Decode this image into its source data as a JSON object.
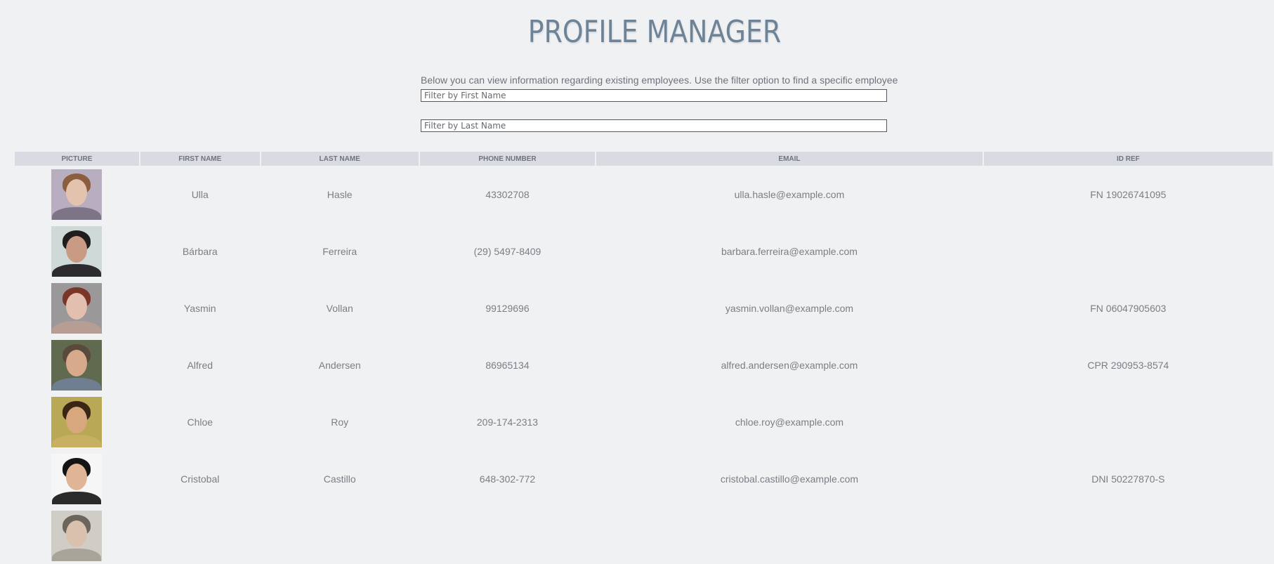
{
  "header": {
    "title": "PROFILE MANAGER",
    "intro": "Below you can view information regarding existing employees. Use the filter option to find a specific employee"
  },
  "filters": {
    "first_name_placeholder": "Filter by First Name",
    "last_name_placeholder": "Filter by Last Name"
  },
  "table": {
    "columns": [
      "PICTURE",
      "FIRST NAME",
      "LAST NAME",
      "PHONE NUMBER",
      "EMAIL",
      "ID REF"
    ],
    "rows": [
      {
        "first": "Ulla",
        "last": "Hasle",
        "phone": "43302708",
        "email": "ulla.hasle@example.com",
        "idref": "FN 19026741095",
        "avatar": {
          "bg": "#b8aebf",
          "hair": "#8a5e3f",
          "skin": "#e3c2ae",
          "shirt": "#7d7488"
        }
      },
      {
        "first": "Bárbara",
        "last": "Ferreira",
        "phone": "(29) 5497-8409",
        "email": "barbara.ferreira@example.com",
        "idref": "",
        "avatar": {
          "bg": "#cfd9d8",
          "hair": "#1f1d1d",
          "skin": "#c99a84",
          "shirt": "#2d2b2e"
        }
      },
      {
        "first": "Yasmin",
        "last": "Vollan",
        "phone": "99129696",
        "email": "yasmin.vollan@example.com",
        "idref": "FN 06047905603",
        "avatar": {
          "bg": "#9a9899",
          "hair": "#7a3627",
          "skin": "#e2bfae",
          "shirt": "#b79e94"
        }
      },
      {
        "first": "Alfred",
        "last": "Andersen",
        "phone": "86965134",
        "email": "alfred.andersen@example.com",
        "idref": "CPR 290953-8574",
        "avatar": {
          "bg": "#5f6a4f",
          "hair": "#5a4a3c",
          "skin": "#d8aa8c",
          "shirt": "#6f7e90"
        }
      },
      {
        "first": "Chloe",
        "last": "Roy",
        "phone": "209-174-2313",
        "email": "chloe.roy@example.com",
        "idref": "",
        "avatar": {
          "bg": "#b9a957",
          "hair": "#3a2614",
          "skin": "#d7a77d",
          "shirt": "#c7b062"
        }
      },
      {
        "first": "Cristobal",
        "last": "Castillo",
        "phone": "648-302-772",
        "email": "cristobal.castillo@example.com",
        "idref": "DNI 50227870-S",
        "avatar": {
          "bg": "#f6f6f6",
          "hair": "#141414",
          "skin": "#e0b497",
          "shirt": "#2a2a2a"
        }
      },
      {
        "first": "",
        "last": "",
        "phone": "",
        "email": "",
        "idref": "",
        "avatar": {
          "bg": "#cfcdc6",
          "hair": "#6b655c",
          "skin": "#d9c1ae",
          "shirt": "#a9a49a"
        }
      }
    ]
  }
}
